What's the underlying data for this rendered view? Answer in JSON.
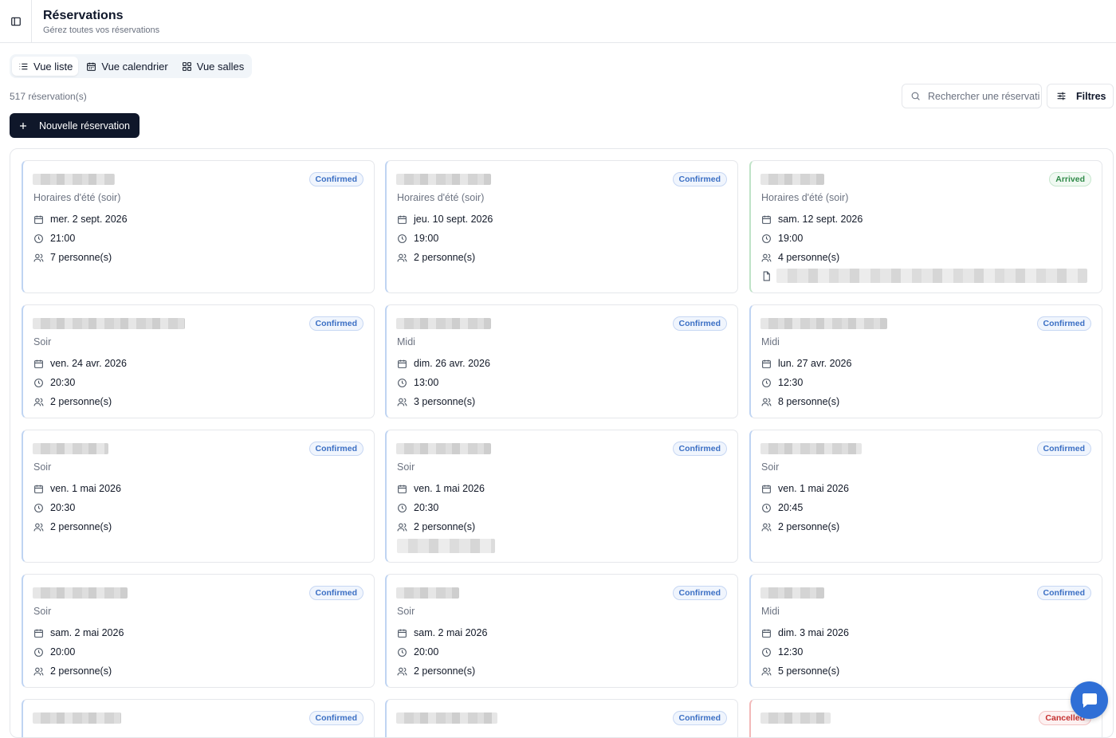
{
  "header": {
    "title": "Réservations",
    "subtitle": "Gérez toutes vos réservations"
  },
  "view_tabs": [
    {
      "label": "Vue liste",
      "icon": "list-icon",
      "active": true
    },
    {
      "label": "Vue calendrier",
      "icon": "calendar-icon",
      "active": false
    },
    {
      "label": "Vue salles",
      "icon": "grid-icon",
      "active": false
    }
  ],
  "toolbar": {
    "count": "517 réservation(s)",
    "search_placeholder": "Rechercher une réservation...",
    "filters_label": "Filtres",
    "new_label": "Nouvelle réservation"
  },
  "colors": {
    "primary": "#0f172a",
    "confirmed": "#3b6fc4",
    "arrived": "#2f8a48",
    "cancelled": "#c53030",
    "chat": "#2f6fd6"
  },
  "reservations": [
    {
      "status": "Confirmed",
      "service": "Horaires d'été (soir)",
      "date": "mer. 2 sept. 2026",
      "time": "21:00",
      "guests": "7 personne(s)"
    },
    {
      "status": "Confirmed",
      "service": "Horaires d'été (soir)",
      "date": "jeu. 10 sept. 2026",
      "time": "19:00",
      "guests": "2 personne(s)"
    },
    {
      "status": "Arrived",
      "service": "Horaires d'été (soir)",
      "date": "sam. 12 sept. 2026",
      "time": "19:00",
      "guests": "4 personne(s)"
    },
    {
      "status": "Confirmed",
      "service": "Soir",
      "date": "ven. 24 avr. 2026",
      "time": "20:30",
      "guests": "2 personne(s)"
    },
    {
      "status": "Confirmed",
      "service": "Midi",
      "date": "dim. 26 avr. 2026",
      "time": "13:00",
      "guests": "3 personne(s)"
    },
    {
      "status": "Confirmed",
      "service": "Midi",
      "date": "lun. 27 avr. 2026",
      "time": "12:30",
      "guests": "8 personne(s)"
    },
    {
      "status": "Confirmed",
      "service": "Soir",
      "date": "ven. 1 mai 2026",
      "time": "20:30",
      "guests": "2 personne(s)"
    },
    {
      "status": "Confirmed",
      "service": "Soir",
      "date": "ven. 1 mai 2026",
      "time": "20:30",
      "guests": "2 personne(s)"
    },
    {
      "status": "Confirmed",
      "service": "Soir",
      "date": "ven. 1 mai 2026",
      "time": "20:45",
      "guests": "2 personne(s)"
    },
    {
      "status": "Confirmed",
      "service": "Soir",
      "date": "sam. 2 mai 2026",
      "time": "20:00",
      "guests": "2 personne(s)"
    },
    {
      "status": "Confirmed",
      "service": "Soir",
      "date": "sam. 2 mai 2026",
      "time": "20:00",
      "guests": "2 personne(s)"
    },
    {
      "status": "Confirmed",
      "service": "Midi",
      "date": "dim. 3 mai 2026",
      "time": "12:30",
      "guests": "5 personne(s)"
    },
    {
      "status": "Confirmed"
    },
    {
      "status": "Confirmed"
    },
    {
      "status": "Cancelled"
    }
  ]
}
